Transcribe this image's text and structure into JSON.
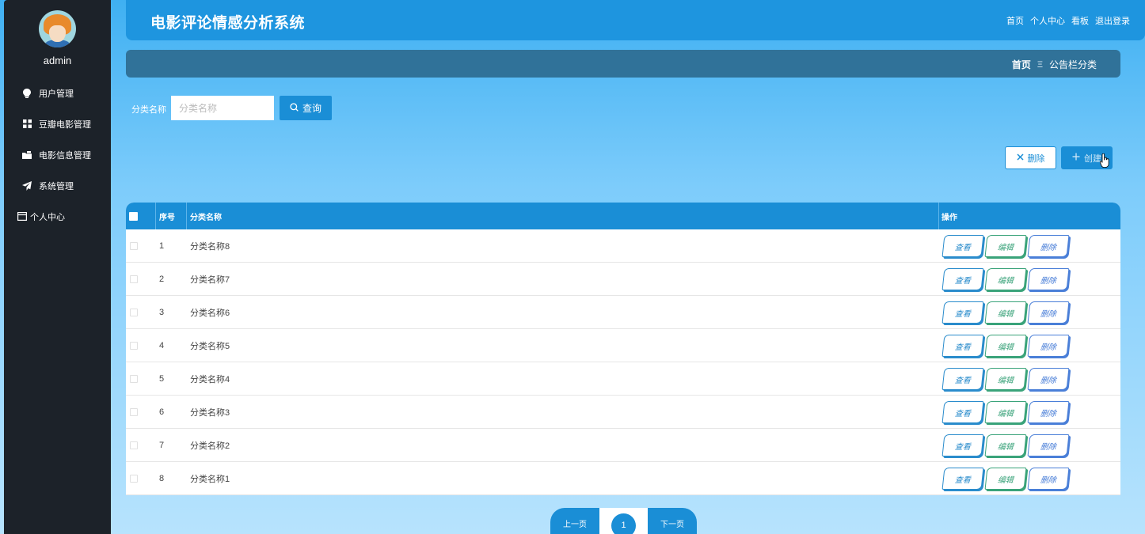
{
  "sidebar": {
    "username": "admin",
    "items": [
      {
        "label": "用户管理",
        "icon": "lightbulb-icon"
      },
      {
        "label": "豆瓣电影管理",
        "icon": "grid-icon"
      },
      {
        "label": "电影信息管理",
        "icon": "folder-icon"
      },
      {
        "label": "系统管理",
        "icon": "send-icon"
      },
      {
        "label": "个人中心",
        "icon": "window-icon"
      }
    ]
  },
  "header": {
    "title": "电影评论情感分析系统",
    "nav": [
      "首页",
      "个人中心",
      "看板",
      "退出登录"
    ]
  },
  "breadcrumb": {
    "home": "首页",
    "separator": "Ξ",
    "current": "公告栏分类"
  },
  "search": {
    "label": "分类名称",
    "placeholder": "分类名称",
    "value": "",
    "button": "查询"
  },
  "actions": {
    "delete": "删除",
    "create": "创建"
  },
  "table": {
    "headers": [
      "序号",
      "分类名称",
      "操作"
    ],
    "rows": [
      {
        "num": "1",
        "name": "分类名称8"
      },
      {
        "num": "2",
        "name": "分类名称7"
      },
      {
        "num": "3",
        "name": "分类名称6"
      },
      {
        "num": "4",
        "name": "分类名称5"
      },
      {
        "num": "5",
        "name": "分类名称4"
      },
      {
        "num": "6",
        "name": "分类名称3"
      },
      {
        "num": "7",
        "name": "分类名称2"
      },
      {
        "num": "8",
        "name": "分类名称1"
      }
    ],
    "row_actions": {
      "view": "查看",
      "edit": "编辑",
      "delete": "删除"
    }
  },
  "pagination": {
    "prev": "上一页",
    "current": "1",
    "next": "下一页"
  },
  "colors": {
    "primary": "#1a8ed6",
    "sidebar": "#1c2229",
    "breadcrumb": "#307299"
  }
}
